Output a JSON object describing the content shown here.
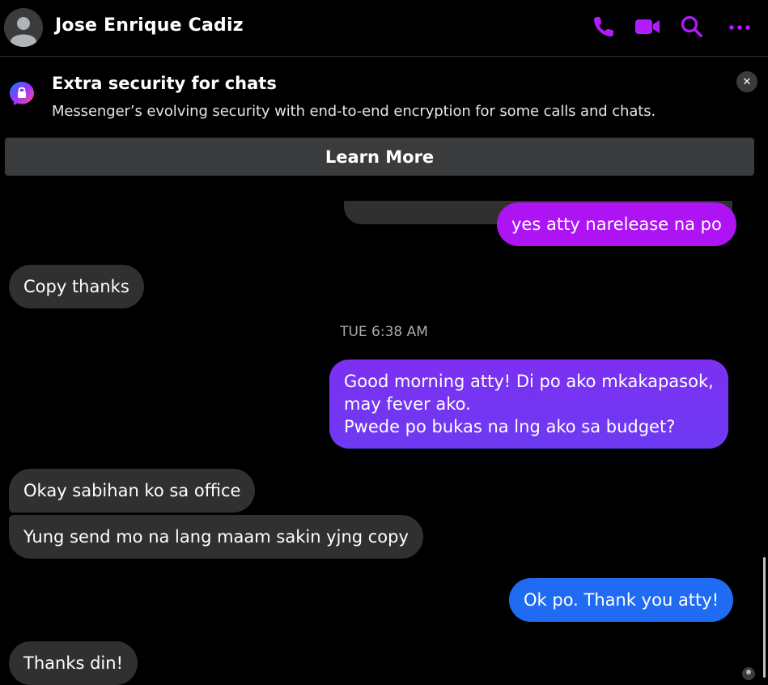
{
  "header": {
    "contact_name": "Jose Enrique Cadiz",
    "icons": [
      "avatar",
      "phone-icon",
      "video-icon",
      "search-icon",
      "more-icon"
    ],
    "accent_color": "#b11cff"
  },
  "banner": {
    "title": "Extra security for chats",
    "text": "Messenger’s evolving security with end-to-end encryption for some calls and chats.",
    "close_label": "✕",
    "button_label": "Learn More"
  },
  "messages": [
    {
      "side": "out",
      "text": "yes atty narelease na po"
    },
    {
      "side": "in",
      "text": "Copy thanks"
    },
    {
      "side": "out",
      "lines": [
        "Good morning atty! Di po ako mkakapasok,",
        "may fever ako.",
        "Pwede po bukas na lng ako sa budget?"
      ]
    },
    {
      "side": "in",
      "text": "Okay sabihan ko sa office"
    },
    {
      "side": "in",
      "text": "Yung send mo na lang maam sakin yjng copy"
    },
    {
      "side": "out",
      "text": "Ok po. Thank you atty!"
    },
    {
      "side": "in",
      "text": "Thanks din!"
    }
  ],
  "timestamp": "TUE 6:38 AM",
  "colors": {
    "background": "#000000",
    "incoming_bubble": "#303030",
    "outgoing_top": "#b011f3",
    "outgoing_mid": "#7e32f1",
    "outgoing_bottom": "#1e6cf3"
  }
}
